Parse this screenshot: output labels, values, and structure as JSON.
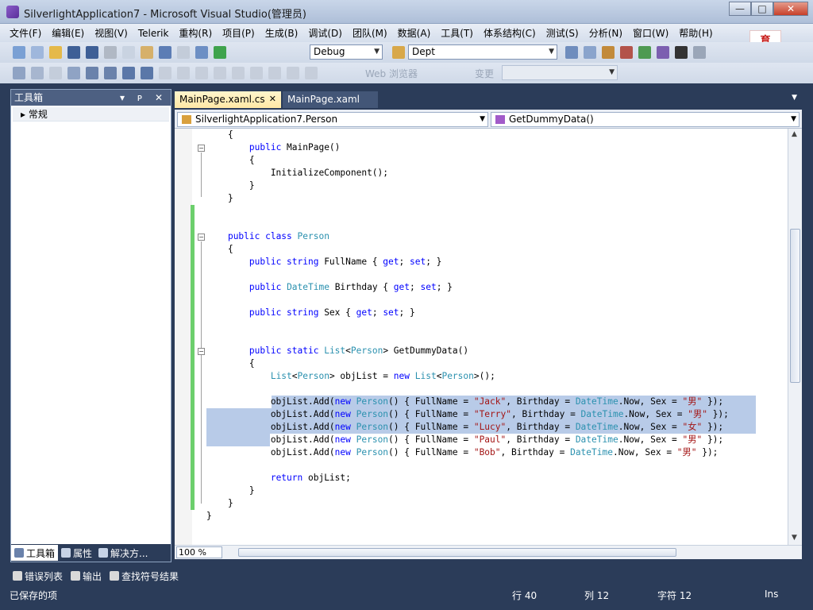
{
  "window": {
    "title": "SilverlightApplication7 - Microsoft Visual Studio(管理员)",
    "min": "—",
    "max": "□",
    "close": "✕"
  },
  "menu": [
    "文件(F)",
    "编辑(E)",
    "视图(V)",
    "Telerik",
    "重构(R)",
    "项目(P)",
    "生成(B)",
    "调试(D)",
    "团队(M)",
    "数据(A)",
    "工具(T)",
    "体系结构(C)",
    "测试(S)",
    "分析(N)",
    "窗口(W)",
    "帮助(H)"
  ],
  "logo_text": [
    "育",
    "教育"
  ],
  "toolbar": {
    "config": "Debug",
    "find": "Dept",
    "web_label": "Web 浏览器",
    "disabled_label": "变更"
  },
  "toolbox": {
    "title": "工具箱",
    "header_buttons": "▾ ᴘ ✕",
    "group": "▸ 常规",
    "tabs": [
      "工具箱",
      "属性",
      "解决方..."
    ]
  },
  "editor": {
    "tabs": [
      {
        "label": "MainPage.xaml.cs",
        "active": true
      },
      {
        "label": "MainPage.xaml",
        "active": false
      }
    ],
    "nav_left": "SilverlightApplication7.Person",
    "nav_right": "GetDummyData()",
    "zoom": "100 %",
    "code_lines": [
      [
        [
          "    {",
          ""
        ]
      ],
      [
        [
          "        ",
          ""
        ],
        [
          "public",
          "kw"
        ],
        [
          " MainPage()",
          ""
        ]
      ],
      [
        [
          "        {",
          ""
        ]
      ],
      [
        [
          "            InitializeComponent();",
          ""
        ]
      ],
      [
        [
          "        }",
          ""
        ]
      ],
      [
        [
          "    }",
          ""
        ]
      ],
      [
        [
          "",
          ""
        ]
      ],
      [
        [
          "",
          ""
        ]
      ],
      [
        [
          "    ",
          ""
        ],
        [
          "public class",
          "kw"
        ],
        [
          " ",
          ""
        ],
        [
          "Person",
          "ty"
        ]
      ],
      [
        [
          "    {",
          ""
        ]
      ],
      [
        [
          "        ",
          ""
        ],
        [
          "public string",
          "kw"
        ],
        [
          " FullName { ",
          ""
        ],
        [
          "get",
          "kw"
        ],
        [
          "; ",
          ""
        ],
        [
          "set",
          "kw"
        ],
        [
          "; }",
          ""
        ]
      ],
      [
        [
          "",
          ""
        ]
      ],
      [
        [
          "        ",
          ""
        ],
        [
          "public",
          "kw"
        ],
        [
          " ",
          ""
        ],
        [
          "DateTime",
          "ty"
        ],
        [
          " Birthday { ",
          ""
        ],
        [
          "get",
          "kw"
        ],
        [
          "; ",
          ""
        ],
        [
          "set",
          "kw"
        ],
        [
          "; }",
          ""
        ]
      ],
      [
        [
          "",
          ""
        ]
      ],
      [
        [
          "        ",
          ""
        ],
        [
          "public string",
          "kw"
        ],
        [
          " Sex { ",
          ""
        ],
        [
          "get",
          "kw"
        ],
        [
          "; ",
          ""
        ],
        [
          "set",
          "kw"
        ],
        [
          "; }",
          ""
        ]
      ],
      [
        [
          "",
          ""
        ]
      ],
      [
        [
          "",
          ""
        ]
      ],
      [
        [
          "        ",
          ""
        ],
        [
          "public static",
          "kw"
        ],
        [
          " ",
          ""
        ],
        [
          "List",
          "ty"
        ],
        [
          "<",
          ""
        ],
        [
          "Person",
          "ty"
        ],
        [
          "> GetDummyData()",
          ""
        ]
      ],
      [
        [
          "        {",
          ""
        ]
      ],
      [
        [
          "            ",
          ""
        ],
        [
          "List",
          "ty"
        ],
        [
          "<",
          ""
        ],
        [
          "Person",
          "ty"
        ],
        [
          "> objList = ",
          ""
        ],
        [
          "new",
          "kw"
        ],
        [
          " ",
          ""
        ],
        [
          "List",
          "ty"
        ],
        [
          "<",
          ""
        ],
        [
          "Person",
          "ty"
        ],
        [
          ">();",
          ""
        ]
      ],
      [
        [
          "",
          ""
        ]
      ],
      [
        [
          "            objList.Add(",
          ""
        ],
        [
          "new",
          "kw"
        ],
        [
          " ",
          ""
        ],
        [
          "Person",
          "ty"
        ],
        [
          "() { FullName = ",
          ""
        ],
        [
          "\"Jack\"",
          "st"
        ],
        [
          ", Birthday = ",
          ""
        ],
        [
          "DateTime",
          "ty"
        ],
        [
          ".Now, Sex = ",
          ""
        ],
        [
          "\"男\"",
          "st"
        ],
        [
          " });",
          ""
        ]
      ],
      [
        [
          "            objList.Add(",
          ""
        ],
        [
          "new",
          "kw"
        ],
        [
          " ",
          ""
        ],
        [
          "Person",
          "ty"
        ],
        [
          "() { FullName = ",
          ""
        ],
        [
          "\"Terry\"",
          "st"
        ],
        [
          ", Birthday = ",
          ""
        ],
        [
          "DateTime",
          "ty"
        ],
        [
          ".Now, Sex = ",
          ""
        ],
        [
          "\"男\"",
          "st"
        ],
        [
          " });",
          ""
        ]
      ],
      [
        [
          "            objList.Add(",
          ""
        ],
        [
          "new",
          "kw"
        ],
        [
          " ",
          ""
        ],
        [
          "Person",
          "ty"
        ],
        [
          "() { FullName = ",
          ""
        ],
        [
          "\"Lucy\"",
          "st"
        ],
        [
          ", Birthday = ",
          ""
        ],
        [
          "DateTime",
          "ty"
        ],
        [
          ".Now, Sex = ",
          ""
        ],
        [
          "\"女\"",
          "st"
        ],
        [
          " });",
          ""
        ]
      ],
      [
        [
          "            objList.Add(",
          ""
        ],
        [
          "new",
          "kw"
        ],
        [
          " ",
          ""
        ],
        [
          "Person",
          "ty"
        ],
        [
          "() { FullName = ",
          ""
        ],
        [
          "\"Paul\"",
          "st"
        ],
        [
          ", Birthday = ",
          ""
        ],
        [
          "DateTime",
          "ty"
        ],
        [
          ".Now, Sex = ",
          ""
        ],
        [
          "\"男\"",
          "st"
        ],
        [
          " });",
          ""
        ]
      ],
      [
        [
          "            objList.Add(",
          ""
        ],
        [
          "new",
          "kw"
        ],
        [
          " ",
          ""
        ],
        [
          "Person",
          "ty"
        ],
        [
          "() { FullName = ",
          ""
        ],
        [
          "\"Bob\"",
          "st"
        ],
        [
          ", Birthday = ",
          ""
        ],
        [
          "DateTime",
          "ty"
        ],
        [
          ".Now, Sex = ",
          ""
        ],
        [
          "\"男\"",
          "st"
        ],
        [
          " });",
          ""
        ]
      ],
      [
        [
          "",
          ""
        ]
      ],
      [
        [
          "            ",
          ""
        ],
        [
          "return",
          "kw"
        ],
        [
          " objList;",
          ""
        ]
      ],
      [
        [
          "        }",
          ""
        ]
      ],
      [
        [
          "    }",
          ""
        ]
      ],
      [
        [
          "}",
          ""
        ]
      ]
    ]
  },
  "output_tabs": [
    "错误列表",
    "输出",
    "查找符号结果"
  ],
  "status": {
    "message": "已保存的项",
    "line": "行 40",
    "col": "列 12",
    "char": "字符 12",
    "mode": "Ins"
  },
  "colors": {
    "keyword": "#0000ff",
    "type": "#2b91af",
    "string": "#a31515",
    "selection": "#b8cbe8",
    "chrome": "#2b3c59"
  }
}
